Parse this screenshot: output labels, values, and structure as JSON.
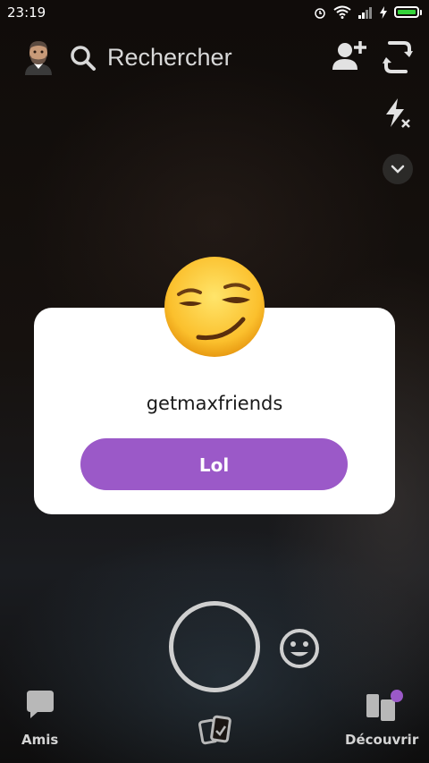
{
  "status_bar": {
    "time": "23:19",
    "battery_color": "#35d33a"
  },
  "header": {
    "search_label": "Rechercher",
    "icons": [
      "avatar",
      "search-icon",
      "add-friend-icon",
      "flip-camera-icon",
      "flash-off-icon",
      "chevron-down-icon"
    ]
  },
  "dialog": {
    "emoji": "smirking-face",
    "title": "getmaxfriends",
    "button_label": "Lol",
    "button_color": "#9b59c8"
  },
  "bottom_nav": {
    "left_label": "Amis",
    "right_label": "Découvrir",
    "badge_color": "#9b59c8"
  }
}
